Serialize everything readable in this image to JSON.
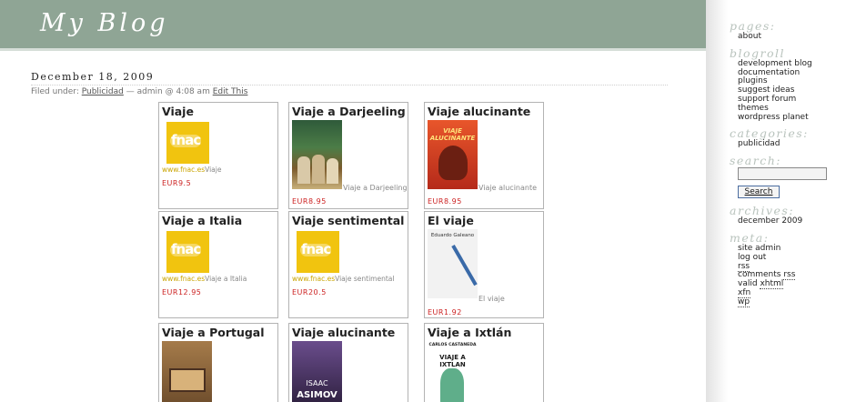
{
  "header": {
    "blog_title": "My Blog"
  },
  "post": {
    "date": "December 18, 2009",
    "filed_label": "Filed under:",
    "category": "Publicidad",
    "byline": "— admin @ 4:08 am",
    "edit_label": "Edit This"
  },
  "products": [
    {
      "title": "Viaje",
      "price": "EUR9.5",
      "url": "www.fnac.es",
      "caption": "Viaje",
      "image": "fnac-logo"
    },
    {
      "title": "Viaje a Darjeeling",
      "price": "EUR8.95",
      "caption": "Viaje a Darjeeling",
      "image": "darjeeling-cover"
    },
    {
      "title": "Viaje alucinante",
      "price": "EUR8.95",
      "caption": "Viaje alucinante",
      "image": "alucinante-cover",
      "cover_text": "VIAJE ALUCINANTE"
    },
    {
      "title": "Viaje a Italia",
      "price": "EUR12.95",
      "url": "www.fnac.es",
      "caption": "Viaje a Italia",
      "image": "fnac-logo"
    },
    {
      "title": "Viaje sentimental",
      "price": "EUR20.5",
      "url": "www.fnac.es",
      "caption": "Viaje sentimental",
      "image": "fnac-logo"
    },
    {
      "title": "El viaje",
      "price": "EUR1.92",
      "caption": "El viaje",
      "image": "galeano-cover",
      "cover_text": "Eduardo Galeano"
    },
    {
      "title": "Viaje a Portugal",
      "image": "portugal-cover"
    },
    {
      "title": "Viaje alucinante",
      "image": "asimov-cover",
      "cover_text_1": "ISAAC",
      "cover_text_2": "ASIMOV"
    },
    {
      "title": "Viaje a Ixtlán",
      "image": "ixtlan-cover",
      "cover_text_1": "CARLOS CASTANEDA",
      "cover_text_2": "VIAJE A IXTLAN"
    }
  ],
  "fnac_word": "fnac",
  "sidebar": {
    "pages_heading": "pages:",
    "pages": [
      "about"
    ],
    "blogroll_heading": "blogroll",
    "blogroll": [
      "development blog",
      "documentation",
      "plugins",
      "suggest ideas",
      "support forum",
      "themes",
      "wordpress planet"
    ],
    "categories_heading": "categories:",
    "categories": [
      "publicidad"
    ],
    "search_heading": "search:",
    "search_button": "Search",
    "archives_heading": "archives:",
    "archives": [
      "december 2009"
    ],
    "meta_heading": "meta:",
    "meta": {
      "site_admin": "site admin",
      "log_out": "log out",
      "rss": "rss",
      "comments": "comments",
      "comments_rss": "rss",
      "valid": "valid",
      "xhtml": "xhtml",
      "xfn": "xfn",
      "wp": "wp"
    }
  },
  "colors": {
    "header_bg": "#8fa595",
    "sidebar_heading": "#b9c3bd",
    "price": "#cc2222",
    "fnac_yellow": "#f1c40f"
  }
}
